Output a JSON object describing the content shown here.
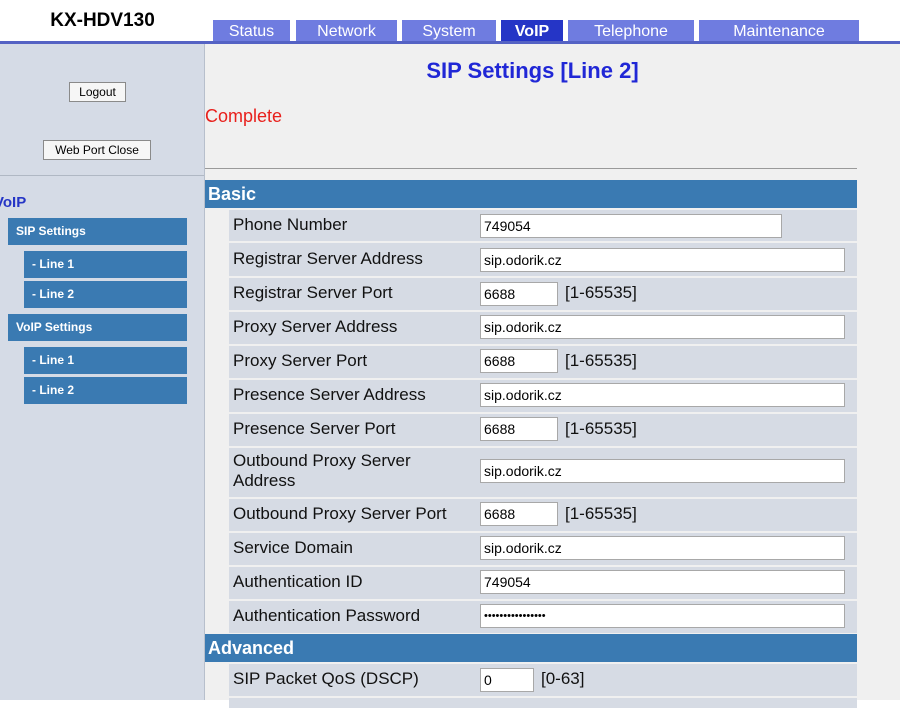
{
  "header": {
    "model": "KX-HDV130",
    "tabs": [
      {
        "label": "Status",
        "active": false
      },
      {
        "label": "Network",
        "active": false
      },
      {
        "label": "System",
        "active": false
      },
      {
        "label": "VoIP",
        "active": true
      },
      {
        "label": "Telephone",
        "active": false
      },
      {
        "label": "Maintenance",
        "active": false
      }
    ]
  },
  "sidebar": {
    "logout_label": "Logout",
    "web_port_close_label": "Web Port Close",
    "section_title": "VoIP",
    "items": [
      {
        "label": "SIP Settings"
      },
      {
        "label": "- Line 1"
      },
      {
        "label": "- Line 2"
      },
      {
        "label": "VoIP Settings"
      },
      {
        "label": "- Line 1"
      },
      {
        "label": "- Line 2"
      }
    ]
  },
  "main": {
    "title": "SIP Settings [Line 2]",
    "status": "Complete",
    "basic": {
      "title": "Basic",
      "rows": [
        {
          "label": "Phone Number",
          "value": "749054",
          "range": ""
        },
        {
          "label": "Registrar Server Address",
          "value": "sip.odorik.cz",
          "range": ""
        },
        {
          "label": "Registrar Server Port",
          "value": "6688",
          "range": "[1-65535]"
        },
        {
          "label": "Proxy Server Address",
          "value": "sip.odorik.cz",
          "range": ""
        },
        {
          "label": "Proxy Server Port",
          "value": "6688",
          "range": "[1-65535]"
        },
        {
          "label": "Presence Server Address",
          "value": "sip.odorik.cz",
          "range": ""
        },
        {
          "label": "Presence Server Port",
          "value": "6688",
          "range": "[1-65535]"
        },
        {
          "label": "Outbound Proxy Server Address",
          "value": "sip.odorik.cz",
          "range": ""
        },
        {
          "label": "Outbound Proxy Server Port",
          "value": "6688",
          "range": "[1-65535]"
        },
        {
          "label": "Service Domain",
          "value": "sip.odorik.cz",
          "range": ""
        },
        {
          "label": "Authentication ID",
          "value": "749054",
          "range": ""
        },
        {
          "label": "Authentication Password",
          "value": "••••••••••••••••",
          "range": ""
        }
      ]
    },
    "advanced": {
      "title": "Advanced",
      "rows": [
        {
          "label": "SIP Packet QoS (DSCP)",
          "value": "0",
          "range": "[0-63]"
        }
      ]
    }
  },
  "colors": {
    "tab": "#6f7ce0",
    "tab_active": "#2535c6",
    "section": "#3a7ab2",
    "row_bg": "#d6dbe4",
    "title": "#2027d6",
    "status": "#e8201c"
  }
}
